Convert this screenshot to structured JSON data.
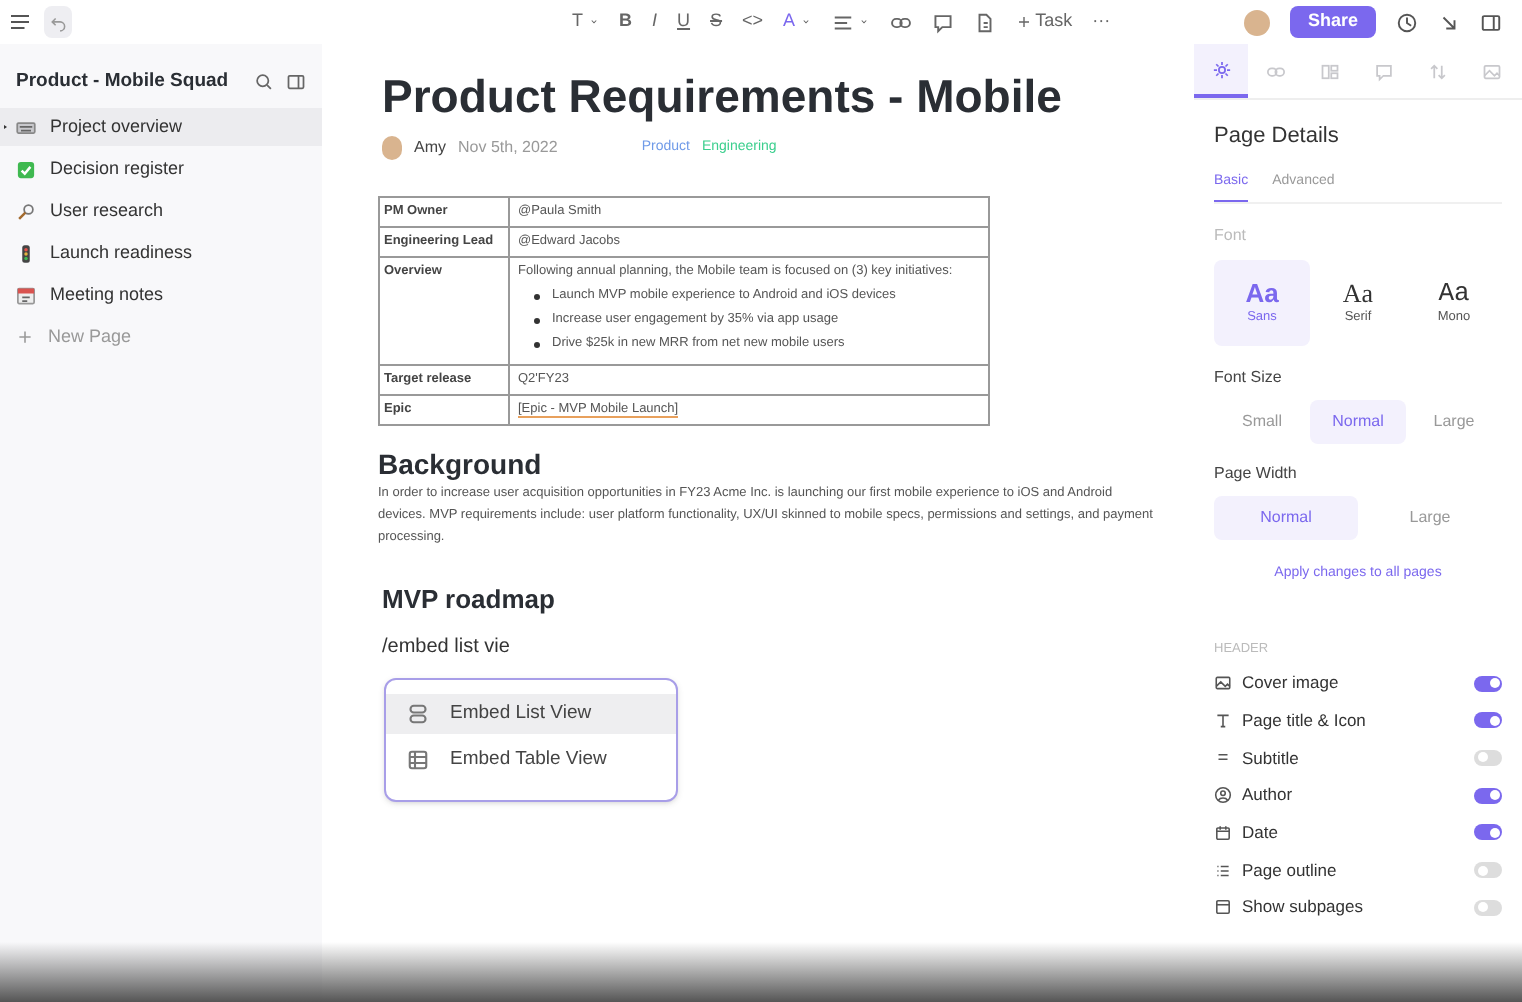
{
  "toolbar": {
    "format_buttons": [
      {
        "kind": "text",
        "label": "T",
        "dropdown": true
      },
      {
        "kind": "bold",
        "label": "B",
        "dropdown": false
      },
      {
        "kind": "italic",
        "label": "I",
        "dropdown": false
      },
      {
        "kind": "underline",
        "label": "U",
        "dropdown": false
      },
      {
        "kind": "strike",
        "label": "S",
        "dropdown": false
      },
      {
        "kind": "code",
        "label": "<>",
        "dropdown": false
      },
      {
        "kind": "color",
        "label": "A",
        "dropdown": true
      },
      {
        "kind": "align",
        "dropdown": true
      },
      {
        "kind": "link",
        "dropdown": false
      },
      {
        "kind": "comment",
        "dropdown": false
      },
      {
        "kind": "doc",
        "dropdown": false
      },
      {
        "kind": "task",
        "label": "Task",
        "dropdown": false
      },
      {
        "kind": "more",
        "label": "···",
        "dropdown": false
      }
    ],
    "share": "Share"
  },
  "sidebar": {
    "title": "Product - Mobile Squad",
    "items": [
      {
        "label": "Project overview",
        "selected": true,
        "has_children": true
      },
      {
        "label": "Decision register",
        "selected": false,
        "has_children": false
      },
      {
        "label": "User research",
        "selected": false,
        "has_children": false
      },
      {
        "label": "Launch readiness",
        "selected": false,
        "has_children": false
      },
      {
        "label": "Meeting notes",
        "selected": false,
        "has_children": false
      }
    ],
    "new_page": "New Page"
  },
  "document": {
    "title": "Product Requirements - Mobile",
    "author": "Amy",
    "date": "Nov 5th, 2022",
    "tags": [
      {
        "label": "Product",
        "color": "#6f9ae8"
      },
      {
        "label": "Engineering",
        "color": "#3ccf8e"
      }
    ],
    "table": [
      {
        "label": "PM Owner",
        "kind": "text",
        "value": "@Paula Smith"
      },
      {
        "label": "Engineering Lead",
        "kind": "text",
        "value": "@Edward Jacobs"
      },
      {
        "label": "Overview",
        "kind": "list",
        "value": "Following annual planning, the Mobile team is focused on (3) key initiatives:",
        "bullets": [
          "Launch MVP mobile experience to Android and iOS devices",
          "Increase user engagement by 35% via app usage",
          "Drive $25k in new MRR from net new mobile users"
        ]
      },
      {
        "label": "Target release",
        "kind": "text",
        "value": "Q2'FY23"
      },
      {
        "label": "Epic",
        "kind": "link",
        "value": "[Epic - MVP Mobile Launch]"
      }
    ],
    "background_heading": "Background",
    "background_text": "In order to increase user acquisition opportunities in FY23 Acme Inc. is launching our first mobile experience to iOS and Android devices. MVP requirements include: user platform functionality, UX/UI skinned to mobile specs, permissions and settings, and payment processing.",
    "roadmap_heading": "MVP roadmap",
    "command": "/embed list vie",
    "menu": [
      {
        "label": "Embed List View",
        "selected": true
      },
      {
        "label": "Embed Table View",
        "selected": false
      }
    ]
  },
  "panel": {
    "tabs": [
      {
        "selected": true
      },
      {
        "selected": false
      },
      {
        "selected": false
      },
      {
        "selected": false
      },
      {
        "selected": false
      },
      {
        "selected": false
      }
    ],
    "title": "Page Details",
    "subtabs": [
      {
        "label": "Basic",
        "selected": true
      },
      {
        "label": "Advanced",
        "selected": false
      }
    ],
    "font_label": "Font",
    "fonts": [
      {
        "sample": "Aa",
        "label": "Sans",
        "selected": true
      },
      {
        "sample": "Aa",
        "label": "Serif",
        "selected": false
      },
      {
        "sample": "Aa",
        "label": "Mono",
        "selected": false
      }
    ],
    "font_size_label": "Font Size",
    "font_sizes": [
      {
        "label": "Small",
        "selected": false
      },
      {
        "label": "Normal",
        "selected": true
      },
      {
        "label": "Large",
        "selected": false
      }
    ],
    "page_width_label": "Page Width",
    "page_widths": [
      {
        "label": "Normal",
        "selected": true
      },
      {
        "label": "Large",
        "selected": false
      }
    ],
    "apply": "Apply changes to all pages",
    "header_label": "HEADER",
    "toggles": [
      {
        "label": "Cover image",
        "on": true
      },
      {
        "label": "Page title & Icon",
        "on": true
      },
      {
        "label": "Subtitle",
        "on": false
      },
      {
        "label": "Author",
        "on": true
      },
      {
        "label": "Date",
        "on": true
      },
      {
        "label": "Page outline",
        "on": false
      },
      {
        "label": "Show subpages",
        "on": false
      }
    ]
  }
}
